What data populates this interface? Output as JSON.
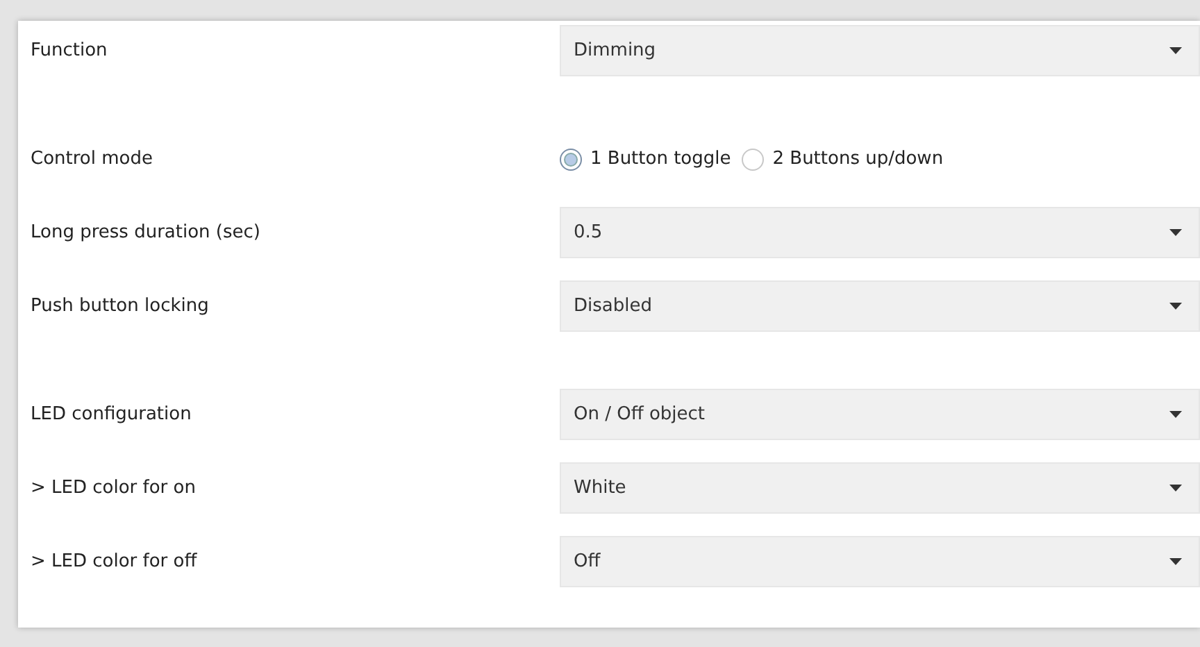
{
  "groups": [
    {
      "rows": [
        {
          "kind": "dropdown",
          "label": "Function",
          "value": "Dimming"
        }
      ]
    },
    {
      "rows": [
        {
          "kind": "radio",
          "label": "Control mode",
          "options": [
            {
              "label": "1 Button toggle",
              "selected": true
            },
            {
              "label": "2 Buttons up/down",
              "selected": false
            }
          ]
        },
        {
          "kind": "dropdown",
          "label": "Long press duration (sec)",
          "value": "0.5"
        },
        {
          "kind": "dropdown",
          "label": "Push button locking",
          "value": "Disabled"
        }
      ]
    },
    {
      "rows": [
        {
          "kind": "dropdown",
          "label": "LED configuration",
          "value": "On / Off object"
        },
        {
          "kind": "dropdown",
          "label": "> LED color for on",
          "value": "White"
        },
        {
          "kind": "dropdown",
          "label": "> LED color for off",
          "value": "Off"
        }
      ]
    }
  ]
}
